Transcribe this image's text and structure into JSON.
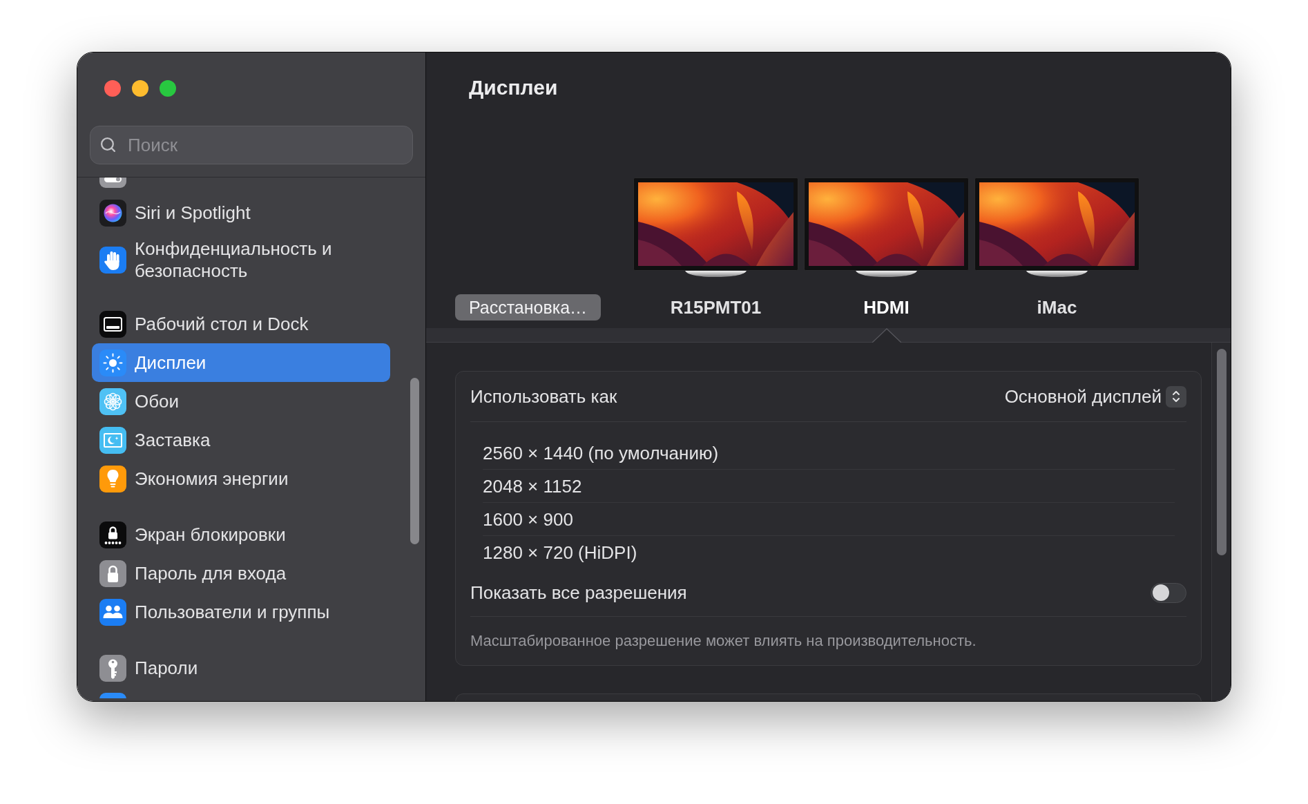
{
  "sidebar": {
    "search": {
      "placeholder": "Поиск"
    },
    "groups": [
      {
        "items": [
          {
            "label": "Siri и Spotlight",
            "selected": false
          },
          {
            "label": "Конфиденциальность и безопасность",
            "selected": false
          }
        ]
      },
      {
        "items": [
          {
            "label": "Рабочий стол и Dock",
            "selected": false
          },
          {
            "label": "Дисплеи",
            "selected": true
          },
          {
            "label": "Обои",
            "selected": false
          },
          {
            "label": "Заставка",
            "selected": false
          },
          {
            "label": "Экономия энергии",
            "selected": false
          }
        ]
      },
      {
        "items": [
          {
            "label": "Экран блокировки",
            "selected": false
          },
          {
            "label": "Пароль для входа",
            "selected": false
          },
          {
            "label": "Пользователи и группы",
            "selected": false
          }
        ]
      },
      {
        "items": [
          {
            "label": "Пароли",
            "selected": false
          }
        ]
      }
    ]
  },
  "main": {
    "title": "Дисплеи",
    "arrange_button": "Расстановка…",
    "displays": [
      {
        "name": "R15PMT01",
        "selected": false
      },
      {
        "name": "HDMI",
        "selected": true
      },
      {
        "name": "iMac",
        "selected": false
      }
    ]
  },
  "settings": {
    "use_as": {
      "label": "Использовать как",
      "value": "Основной дисплей"
    },
    "resolutions": [
      {
        "label": "2560 × 1440 (по умолчанию)",
        "selected": false
      },
      {
        "label": "2048 × 1152",
        "selected": false
      },
      {
        "label": "1600 × 900",
        "selected": false
      },
      {
        "label": "1280 × 720 (HiDPI)",
        "selected": false
      }
    ],
    "show_all": {
      "label": "Показать все разрешения",
      "on": false
    },
    "note": "Масштабированное разрешение может влиять на производительность."
  }
}
